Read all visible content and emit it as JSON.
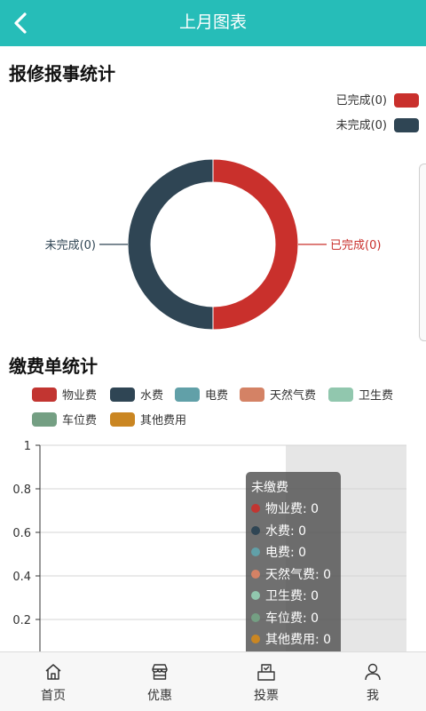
{
  "header": {
    "title": "上月图表"
  },
  "repair_section": {
    "title": "报修报事统计",
    "legend": [
      {
        "label": "已完成(0)",
        "color": "#c9302c"
      },
      {
        "label": "未完成(0)",
        "color": "#2f4554"
      }
    ],
    "chart_data": {
      "type": "pie",
      "labels": [
        "已完成(0)",
        "未完成(0)"
      ],
      "values": [
        0,
        0
      ],
      "colors": [
        "#c9302c",
        "#2f4554"
      ],
      "legend_position": "top-right"
    }
  },
  "fee_section": {
    "title": "缴费单统计",
    "legend": [
      {
        "label": "物业费",
        "color": "#c23531"
      },
      {
        "label": "水费",
        "color": "#2f4554"
      },
      {
        "label": "电费",
        "color": "#61a0a8"
      },
      {
        "label": "天然气费",
        "color": "#d48265"
      },
      {
        "label": "卫生费",
        "color": "#91c7ae"
      },
      {
        "label": "车位费",
        "color": "#749f83"
      },
      {
        "label": "其他费用",
        "color": "#ca8622"
      }
    ],
    "chart_data": {
      "type": "bar",
      "categories": [
        "未缴费"
      ],
      "series": [
        {
          "name": "物业费",
          "values": [
            0
          ]
        },
        {
          "name": "水费",
          "values": [
            0
          ]
        },
        {
          "name": "电费",
          "values": [
            0
          ]
        },
        {
          "name": "天然气费",
          "values": [
            0
          ]
        },
        {
          "name": "卫生费",
          "values": [
            0
          ]
        },
        {
          "name": "车位费",
          "values": [
            0
          ]
        },
        {
          "name": "其他费用",
          "values": [
            0
          ]
        }
      ],
      "ylim": [
        0,
        1
      ],
      "yticks": [
        "1",
        "0.8",
        "0.6",
        "0.4",
        "0.2"
      ],
      "grid": true
    },
    "tooltip": {
      "title": "未缴费",
      "rows": [
        "物业费: 0",
        "水费: 0",
        "电费: 0",
        "天然气费: 0",
        "卫生费: 0",
        "车位费: 0",
        "其他费用: 0"
      ]
    }
  },
  "tabbar": {
    "items": [
      {
        "label": "首页",
        "icon": "home-icon"
      },
      {
        "label": "优惠",
        "icon": "shop-icon"
      },
      {
        "label": "投票",
        "icon": "vote-icon"
      },
      {
        "label": "我",
        "icon": "person-icon"
      }
    ]
  }
}
